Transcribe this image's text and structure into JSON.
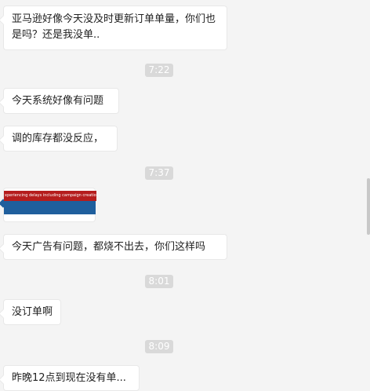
{
  "messages": [
    {
      "text": "亚马逊好像今天没及时更新订单单量，你们也是吗？还是我没单.."
    },
    {
      "text": "今天系统好像有问题"
    },
    {
      "text": "调的库存都没反应，"
    },
    {
      "text": "今天广告有问题，都烧不出去，你们这样吗"
    },
    {
      "text": "没订单啊"
    },
    {
      "text": "昨晚12点到现在没有单..."
    }
  ],
  "timestamps": [
    "7:22",
    "7:37",
    "8:01",
    "8:09"
  ],
  "image_message": {
    "banner_text": "xperiencing delays including campaign creation and"
  },
  "colors": {
    "background": "#f4f4f4",
    "bubble": "#ffffff",
    "timestamp_bg": "#d9d9d9",
    "image_red": "#b51d1d",
    "image_blue": "#1f5f9d"
  }
}
